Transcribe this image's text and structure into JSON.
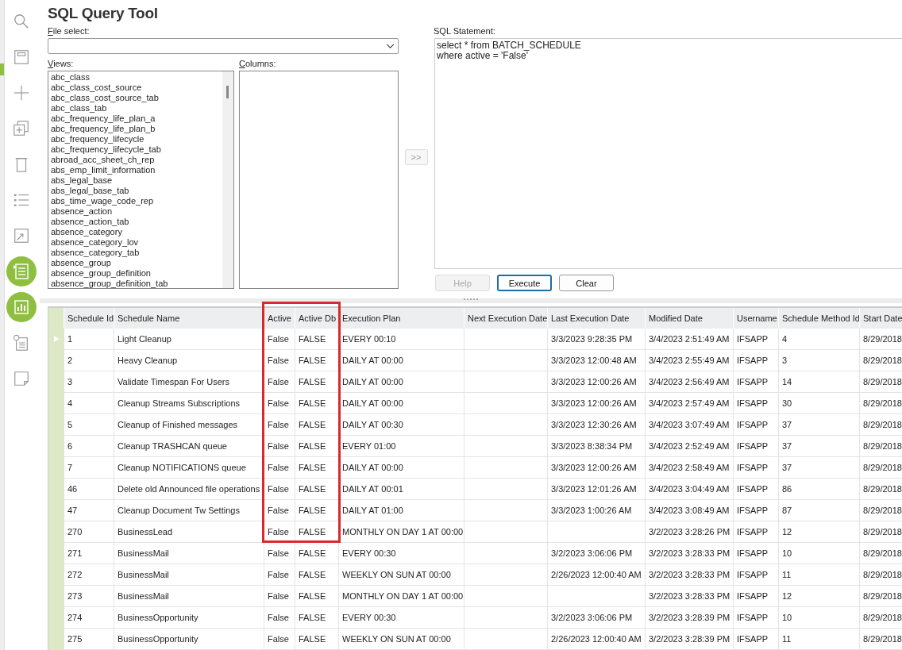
{
  "title": "SQL Query Tool",
  "file_select": {
    "label": "File select:"
  },
  "views": {
    "label": "Views:",
    "items": [
      "abc_class",
      "abc_class_cost_source",
      "abc_class_cost_source_tab",
      "abc_class_tab",
      "abc_frequency_life_plan_a",
      "abc_frequency_life_plan_b",
      "abc_frequency_lifecycle",
      "abc_frequency_lifecycle_tab",
      "abroad_acc_sheet_ch_rep",
      "abs_emp_limit_information",
      "abs_legal_base",
      "abs_legal_base_tab",
      "abs_time_wage_code_rep",
      "absence_action",
      "absence_action_tab",
      "absence_category",
      "absence_category_lov",
      "absence_category_tab",
      "absence_group",
      "absence_group_definition",
      "absence_group_definition_tab"
    ]
  },
  "columns": {
    "label": "Columns:"
  },
  "add_button": {
    "label": ">>",
    "disabled": true
  },
  "sql": {
    "label": "SQL Statement:",
    "value": "select * from BATCH_SCHEDULE\nwhere active = 'False'"
  },
  "buttons": [
    {
      "label": "Help",
      "disabled": true,
      "focused": false
    },
    {
      "label": "Execute",
      "disabled": false,
      "focused": true
    },
    {
      "label": "Clear",
      "disabled": false,
      "focused": false
    }
  ],
  "grid": {
    "columns": [
      "Schedule Id",
      "Schedule Name",
      "Active",
      "Active Db",
      "Execution Plan",
      "Next Execution Date",
      "Last Execution Date",
      "Modified Date",
      "Username",
      "Schedule Method Id",
      "Start Date"
    ],
    "rows": [
      {
        "selected": true,
        "cells": [
          "1",
          "Light Cleanup",
          "False",
          "FALSE",
          "EVERY 00:10",
          "",
          "3/3/2023 9:28:35 PM",
          "3/4/2023 2:51:49 AM",
          "IFSAPP",
          "4",
          "8/29/2018"
        ]
      },
      {
        "selected": false,
        "cells": [
          "2",
          "Heavy Cleanup",
          "False",
          "FALSE",
          "DAILY AT 00:00",
          "",
          "3/3/2023 12:00:48 AM",
          "3/4/2023 2:55:49 AM",
          "IFSAPP",
          "3",
          "8/29/2018"
        ]
      },
      {
        "selected": false,
        "cells": [
          "3",
          "Validate Timespan For Users",
          "False",
          "FALSE",
          "DAILY AT 00:00",
          "",
          "3/3/2023 12:00:26 AM",
          "3/4/2023 2:56:49 AM",
          "IFSAPP",
          "14",
          "8/29/2018"
        ]
      },
      {
        "selected": false,
        "cells": [
          "4",
          "Cleanup Streams Subscriptions",
          "False",
          "FALSE",
          "DAILY AT 00:00",
          "",
          "3/3/2023 12:00:26 AM",
          "3/4/2023 2:57:49 AM",
          "IFSAPP",
          "30",
          "8/29/2018"
        ]
      },
      {
        "selected": false,
        "cells": [
          "5",
          "Cleanup of Finished messages",
          "False",
          "FALSE",
          "DAILY AT 00:30",
          "",
          "3/3/2023 12:30:26 AM",
          "3/4/2023 3:07:49 AM",
          "IFSAPP",
          "37",
          "8/29/2018"
        ]
      },
      {
        "selected": false,
        "cells": [
          "6",
          "Cleanup TRASHCAN queue",
          "False",
          "FALSE",
          "EVERY 01:00",
          "",
          "3/3/2023 8:38:34 PM",
          "3/4/2023 2:52:49 AM",
          "IFSAPP",
          "37",
          "8/29/2018"
        ]
      },
      {
        "selected": false,
        "cells": [
          "7",
          "Cleanup NOTIFICATIONS queue",
          "False",
          "FALSE",
          "DAILY AT 00:00",
          "",
          "3/3/2023 12:00:26 AM",
          "3/4/2023 2:58:49 AM",
          "IFSAPP",
          "37",
          "8/29/2018"
        ]
      },
      {
        "selected": false,
        "cells": [
          "46",
          "Delete old Announced file operations",
          "False",
          "FALSE",
          "DAILY AT 00:01",
          "",
          "3/3/2023 12:01:26 AM",
          "3/4/2023 3:04:49 AM",
          "IFSAPP",
          "86",
          "8/29/2018"
        ]
      },
      {
        "selected": false,
        "cells": [
          "47",
          "Cleanup Document Tw Settings",
          "False",
          "FALSE",
          "DAILY AT 01:00",
          "",
          "3/3/2023 1:00:26 AM",
          "3/4/2023 3:08:49 AM",
          "IFSAPP",
          "87",
          "8/29/2018"
        ]
      },
      {
        "selected": false,
        "cells": [
          "270",
          "BusinessLead",
          "False",
          "FALSE",
          "MONTHLY ON DAY 1 AT 00:00",
          "",
          "",
          "3/2/2023 3:28:26 PM",
          "IFSAPP",
          "12",
          "8/29/2018"
        ]
      },
      {
        "selected": false,
        "cells": [
          "271",
          "BusinessMail",
          "False",
          "FALSE",
          "EVERY 00:30",
          "",
          "3/2/2023 3:06:06 PM",
          "3/2/2023 3:28:33 PM",
          "IFSAPP",
          "10",
          "8/29/2018"
        ]
      },
      {
        "selected": false,
        "cells": [
          "272",
          "BusinessMail",
          "False",
          "FALSE",
          "WEEKLY ON SUN AT 00:00",
          "",
          "2/26/2023 12:00:40 AM",
          "3/2/2023 3:28:33 PM",
          "IFSAPP",
          "11",
          "8/29/2018"
        ]
      },
      {
        "selected": false,
        "cells": [
          "273",
          "BusinessMail",
          "False",
          "FALSE",
          "MONTHLY ON DAY 1 AT 00:00",
          "",
          "",
          "3/2/2023 3:28:33 PM",
          "IFSAPP",
          "12",
          "8/29/2018"
        ]
      },
      {
        "selected": false,
        "cells": [
          "274",
          "BusinessOpportunity",
          "False",
          "FALSE",
          "EVERY 00:30",
          "",
          "3/2/2023 3:06:06 PM",
          "3/2/2023 3:28:39 PM",
          "IFSAPP",
          "10",
          "8/29/2018"
        ]
      },
      {
        "selected": false,
        "cells": [
          "275",
          "BusinessOpportunity",
          "False",
          "FALSE",
          "WEEKLY ON SUN AT 00:00",
          "",
          "2/26/2023 12:00:40 AM",
          "3/2/2023 3:28:39 PM",
          "IFSAPP",
          "11",
          "8/29/2018"
        ]
      }
    ]
  }
}
